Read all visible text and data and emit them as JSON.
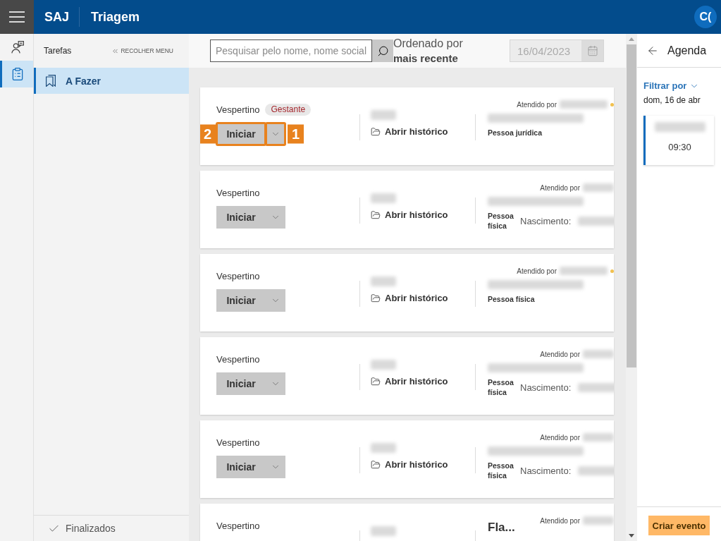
{
  "top_bar": {
    "product": "SAJ",
    "module": "Triagem",
    "avatar": "C("
  },
  "rail": [
    {
      "kind": "attendance",
      "selected": false
    },
    {
      "kind": "tasks",
      "selected": true
    }
  ],
  "side_menu": {
    "title": "Tarefas",
    "collapse": "RECOLHER MENU",
    "items": [
      {
        "label": "A Fazer",
        "selected": true
      }
    ],
    "footer": "Finalizados"
  },
  "toolbar": {
    "search": {
      "placeholder": "Pesquisar pelo nome, nome social"
    },
    "sort": {
      "label": "Ordenado por",
      "value": "mais recente"
    },
    "date": {
      "value": "16/04/2023",
      "disabled": true
    }
  },
  "cards": [
    {
      "shift": "Vespertino",
      "tag": "Gestante",
      "button": "Iniciar",
      "callouts": [
        {
          "kind": "start",
          "label": "2"
        },
        {
          "kind": "menu",
          "label": "1"
        }
      ],
      "history": "Abrir histórico",
      "attended": "Atendido por",
      "flag": true,
      "person_type": "Pessoa jurídica"
    },
    {
      "shift": "Vespertino",
      "button": "Iniciar",
      "history": "Abrir histórico",
      "attended": "Atendido por",
      "flag": false,
      "person_type": "Pessoa física",
      "birth": "Nascimento:"
    },
    {
      "shift": "Vespertino",
      "button": "Iniciar",
      "history": "Abrir histórico",
      "attended": "Atendido por",
      "flag": true,
      "person_type": "Pessoa física"
    },
    {
      "shift": "Vespertino",
      "button": "Iniciar",
      "history": "Abrir histórico",
      "attended": "Atendido por",
      "flag": false,
      "person_type": "Pessoa física",
      "birth": "Nascimento:"
    },
    {
      "shift": "Vespertino",
      "button": "Iniciar",
      "history": "Abrir histórico",
      "attended": "Atendido por",
      "flag": false,
      "person_type": "Pessoa física",
      "birth": "Nascimento:"
    },
    {
      "shift": "Vespertino",
      "attended": "Atendido por",
      "flag": false,
      "name": "Fla..."
    }
  ],
  "agenda": {
    "title": "Agenda",
    "filter": "Filtrar por",
    "date": "dom, 16 de abr",
    "events": [
      {
        "time": "09:30"
      }
    ],
    "create": "Criar evento"
  }
}
